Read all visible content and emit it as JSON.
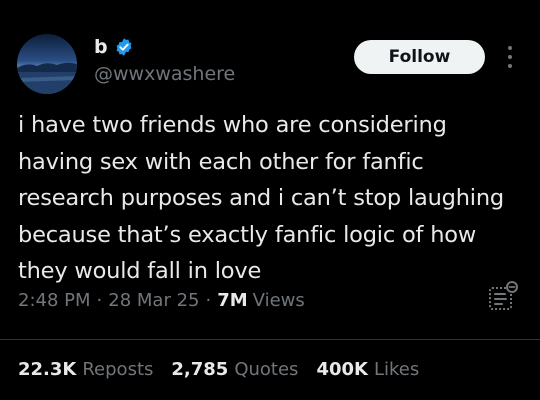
{
  "author": {
    "display_name": "b",
    "handle": "@wwxwashere",
    "verified": true
  },
  "follow_button": {
    "label": "Follow"
  },
  "tweet": {
    "text": "i have two friends who are considering having sex with each other for fanfic research purposes and i can’t stop laughing because that’s exactly fanfic logic of how they would fall in love"
  },
  "meta": {
    "time": "2:48 PM",
    "date": "28 Mar 25",
    "views_count": "7M",
    "views_label": "Views",
    "separator": "·"
  },
  "stats": {
    "reposts_count": "22.3K",
    "reposts_label": "Reposts",
    "quotes_count": "2,785",
    "quotes_label": "Quotes",
    "likes_count": "400K",
    "likes_label": "Likes"
  },
  "colors": {
    "background": "#000000",
    "text_primary": "#e7e9ea",
    "text_secondary": "#71767b",
    "verified_blue": "#1d9bf0",
    "follow_bg": "#eff3f4"
  },
  "icons": [
    "avatar-image",
    "verified-badge-icon",
    "more-options-icon",
    "grok-analyze-icon"
  ]
}
